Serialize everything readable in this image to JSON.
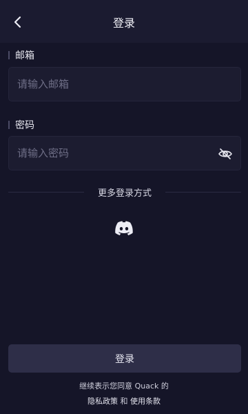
{
  "header": {
    "title": "登录"
  },
  "email": {
    "label": "邮箱",
    "placeholder": "请输入邮箱"
  },
  "password": {
    "label": "密码",
    "placeholder": "请输入密码"
  },
  "divider": {
    "label": "更多登录方式"
  },
  "social": {
    "icon": "discord-icon"
  },
  "login_button": {
    "label": "登录"
  },
  "agreement": {
    "line1": "继续表示您同意 Quack 的",
    "privacy_link": "隐私政策",
    "and": " 和 ",
    "terms_link": "使用条款"
  },
  "colors": {
    "background": "#151528",
    "header": "#1b1b30",
    "input_bg": "#1c1c30",
    "button_bg": "#2e2e48",
    "placeholder": "#6e6e86"
  }
}
